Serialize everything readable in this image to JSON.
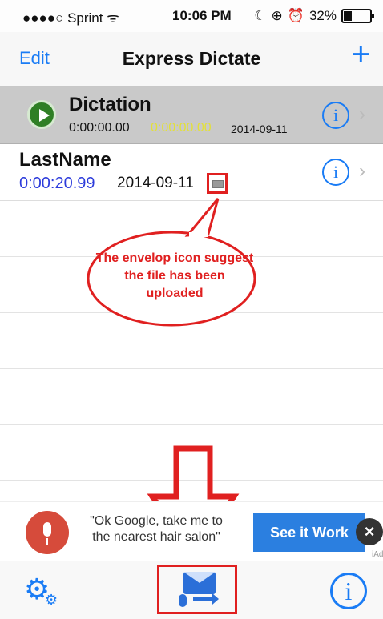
{
  "status_bar": {
    "carrier": "●●●●○ Sprint ᯤ",
    "time": "10:06 PM",
    "battery": "32%",
    "icons": [
      "moon-icon",
      "lock-rotation-icon",
      "alarm-icon",
      "battery-icon"
    ]
  },
  "nav": {
    "edit_label": "Edit",
    "title": "Express Dictate",
    "add_label": "+"
  },
  "recordings": [
    {
      "name": "Dictation",
      "duration": "0:00:00.00",
      "elapsed": "0:00:00.00",
      "date": "2014-09-11"
    },
    {
      "name": "LastName",
      "duration": "0:00:20.99",
      "date": "2014-09-11"
    }
  ],
  "annotation": {
    "callout_text": "The envelop icon suggest the file has been uploaded",
    "color": "#e02020"
  },
  "ad": {
    "text": "\"Ok Google, take me to the nearest hair salon\"",
    "button_label": "See it Work",
    "close_label": "×",
    "iad_label": "iAd"
  },
  "tab_bar": {
    "left_icon": "settings-gears-icon",
    "center_icon": "dictate-send-mail-icon",
    "right_icon": "info-icon"
  },
  "colors": {
    "accent": "#1a7cf5",
    "highlight_row": "#c9c9c9",
    "duration_blue": "#2c3bdb",
    "elapsed_yellow": "#e3e03a"
  }
}
